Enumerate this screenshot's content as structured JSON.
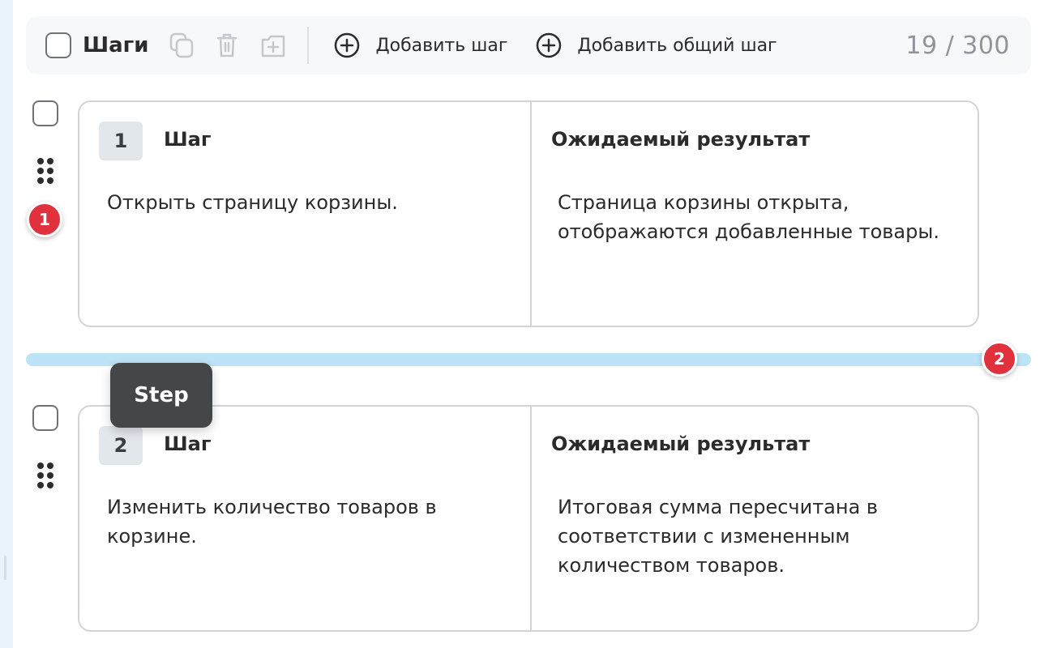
{
  "toolbar": {
    "title": "Шаги",
    "add_step_label": "Добавить шаг",
    "add_shared_step_label": "Добавить общий шаг",
    "counter": "19 / 300"
  },
  "steps": [
    {
      "number": "1",
      "step_header": "Шаг",
      "result_header": "Ожидаемый результат",
      "step_text": "Открыть страницу корзины.",
      "result_text": "Страница корзины открыта, отображаются добавленные товары."
    },
    {
      "number": "2",
      "step_header": "Шаг",
      "result_header": "Ожидаемый результат",
      "step_text": "Изменить количество товаров в корзине.",
      "result_text": "Итоговая сумма пересчитана в соответствии с измененным количеством товаров."
    }
  ],
  "badges": {
    "first": "1",
    "second": "2"
  },
  "tooltip": {
    "text": "Step"
  },
  "colors": {
    "badge": "#e0313d",
    "drop_line": "#bde3f6",
    "tooltip_bg": "#444648"
  }
}
